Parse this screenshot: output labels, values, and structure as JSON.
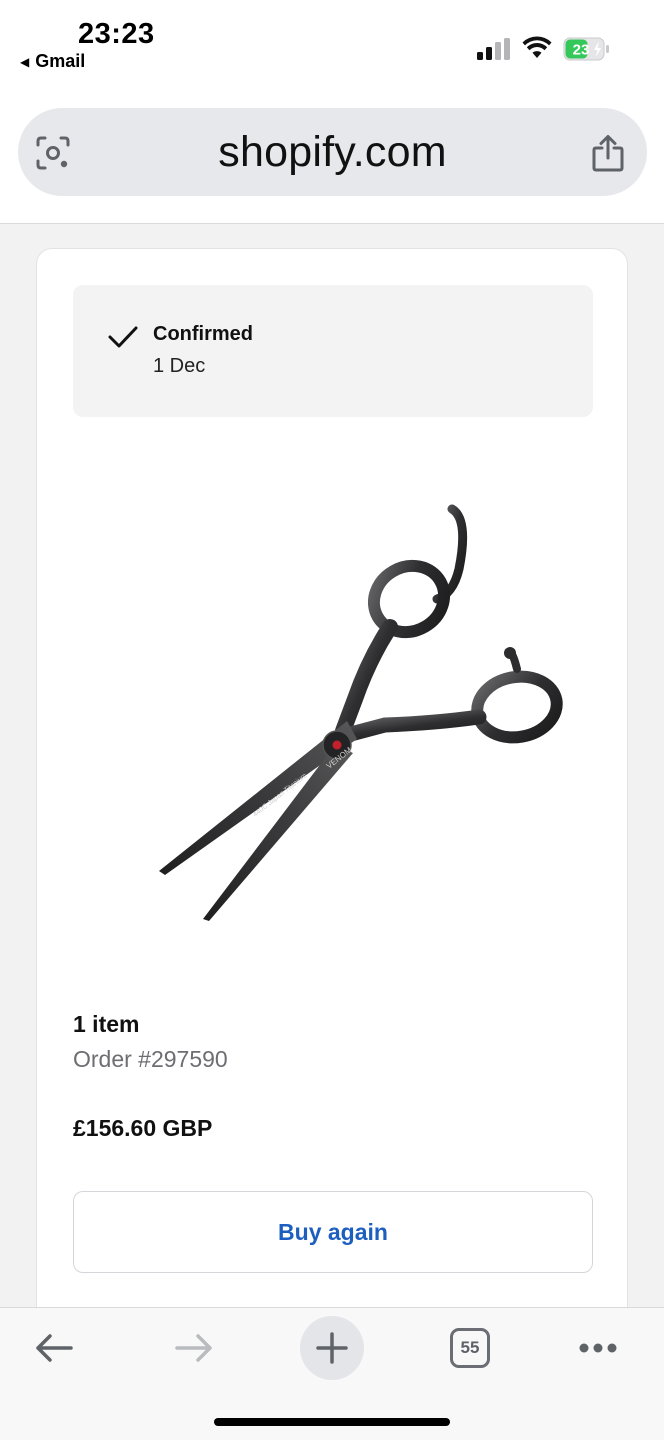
{
  "status_bar": {
    "time": "23:23",
    "back_app": "Gmail",
    "battery_level": "23"
  },
  "browser": {
    "url": "shopify.com",
    "tab_count": "55"
  },
  "order": {
    "status_title": "Confirmed",
    "status_date": "1 Dec",
    "product_image_alt": "Hair cutting scissors",
    "product_engraving": "440C Japan Titanium",
    "product_brand": "VENOM",
    "item_count": "1 item",
    "order_number": "Order #297590",
    "price": "£156.60 GBP",
    "buy_again_label": "Buy again"
  },
  "colors": {
    "accent_link": "#1d5fbf",
    "battery_green": "#34c759"
  },
  "icons": {
    "lens": "lens-icon",
    "share": "share-icon",
    "check": "check-icon",
    "back": "back-arrow-icon",
    "forward": "forward-arrow-icon",
    "new_tab": "plus-icon",
    "more": "more-icon"
  }
}
